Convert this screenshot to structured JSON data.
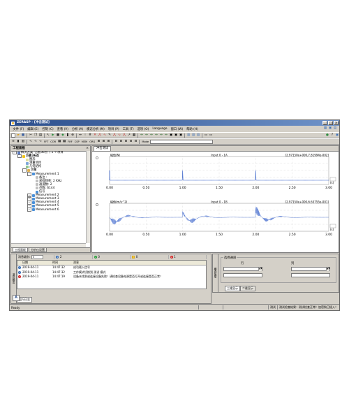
{
  "title": "ZERASP - [冲击测试]",
  "menu": [
    "文件 (F)",
    "编辑 (E)",
    "控制 (C)",
    "查看 (V)",
    "分析 (A)",
    "模态分析 (M)",
    "项目 (P)",
    "工具 (T)",
    "选项 (O)",
    "Language",
    "窗口 (W)",
    "帮助 (H)"
  ],
  "toolbar": {
    "labels": [
      "FFT",
      "COR",
      "FRF",
      "CSP",
      "MEM",
      "ORG"
    ],
    "mode_label": "Mode",
    "mode_value": ""
  },
  "project_panel": {
    "title": "工程面板",
    "tree": [
      {
        "label": "解决方案 '方板36点' ( 1 个项目",
        "level": 0,
        "color": "#5b7bbf",
        "exp": "-"
      },
      {
        "label": "方板36点",
        "level": 1,
        "color": "#f0c419",
        "exp": "-",
        "bold": true
      },
      {
        "label": "图形",
        "level": 2,
        "color": "#e0e0a0",
        "exp": ""
      },
      {
        "label": "测量项目",
        "level": 2,
        "color": "#7fa7d9",
        "exp": ""
      },
      {
        "label": "几何结构",
        "level": 2,
        "color": "#8fc78f",
        "exp": ""
      },
      {
        "label": "测量",
        "level": 2,
        "color": "#e0b050",
        "exp": "-"
      },
      {
        "label": "Measurement 1",
        "level": 3,
        "color": "#4a90d9",
        "exp": "-"
      },
      {
        "label": "备注 :",
        "level": 4,
        "color": "#c0c0c0",
        "exp": ""
      },
      {
        "label": "采样频率: 2 KHz",
        "level": 4,
        "color": "#c0c0c0",
        "exp": ""
      },
      {
        "label": "通道数: 2",
        "level": 4,
        "color": "#c0c0c0",
        "exp": ""
      },
      {
        "label": "点数: 6144",
        "level": 4,
        "color": "#c0c0c0",
        "exp": ""
      },
      {
        "label": "信号",
        "level": 4,
        "color": "#4a90d9",
        "exp": ""
      },
      {
        "label": "Measurement 2",
        "level": 3,
        "color": "#4a90d9",
        "exp": "+"
      },
      {
        "label": "Measurement 3",
        "level": 3,
        "color": "#4a90d9",
        "exp": "+"
      },
      {
        "label": "Measurement 4",
        "level": 3,
        "color": "#4a90d9",
        "exp": "+"
      },
      {
        "label": "Measurement 5",
        "level": 3,
        "color": "#4a90d9",
        "exp": "+"
      },
      {
        "label": "Measurement 6",
        "level": 3,
        "color": "#4a90d9",
        "exp": "+"
      }
    ],
    "tabs": [
      "工程面板",
      "分析仪设置"
    ]
  },
  "document": {
    "tab": "冲击测试",
    "plot1": {
      "ylabel": "幅值(N)",
      "title": "Input 0 - 1A",
      "readout": "[2.97150e+000,7.81994e-002]",
      "unit": "(s)",
      "ticks": [
        "0.00",
        "0.50",
        "1.00",
        "1.50",
        "2.00",
        "2.50",
        "3.00"
      ]
    },
    "plot2": {
      "ylabel": "幅值(m/s^2)",
      "title": "Input 0 - 1B",
      "readout": "[2.97150e+000,6.63755e-001]",
      "unit": "(s)",
      "ticks": [
        "0.00",
        "0.50",
        "1.00",
        "1.50",
        "2.00",
        "2.50",
        "3.00"
      ]
    }
  },
  "messages": {
    "caption": "消息输出",
    "filter_label": "消息级别:",
    "filter_value": "0",
    "counts": [
      {
        "icon": "download-icon",
        "color": "#3b6fb6",
        "value": "2"
      },
      {
        "icon": "check-icon",
        "color": "#2e9e3f",
        "value": "0"
      },
      {
        "icon": "warning-icon",
        "color": "#e0b020",
        "value": "0"
      },
      {
        "icon": "error-icon",
        "color": "#d02020",
        "value": "1"
      }
    ],
    "headers": [
      "",
      "日期",
      "时间",
      "消息"
    ],
    "rows": [
      {
        "type": "info",
        "color": "#3b6fb6",
        "date": "2019-04-11",
        "time": "14:47:32",
        "msg": "成功载入信号"
      },
      {
        "type": "info",
        "color": "#3b6fb6",
        "date": "2019-04-11",
        "time": "14:47:32",
        "msg": "工作模式切换到 测试 模式"
      },
      {
        "type": "error",
        "color": "#d02020",
        "date": "2019-04-11",
        "time": "14:47:19",
        "msg": "设备未找到或连接设备失败！请检查设备电源是否打开或连接是否正常！"
      }
    ],
    "tab": "运行日志",
    "a_label": "A"
  },
  "mode_panel": {
    "caption": "模态振型",
    "group_title": "选择通道",
    "row_label": "行",
    "col_label": "列",
    "tabs": [
      "三维显示",
      "二维显示"
    ]
  },
  "status": {
    "left": "Ready",
    "mode": "测试",
    "message": "测试检查结果：测试检查正常！加密狗已插入！"
  }
}
